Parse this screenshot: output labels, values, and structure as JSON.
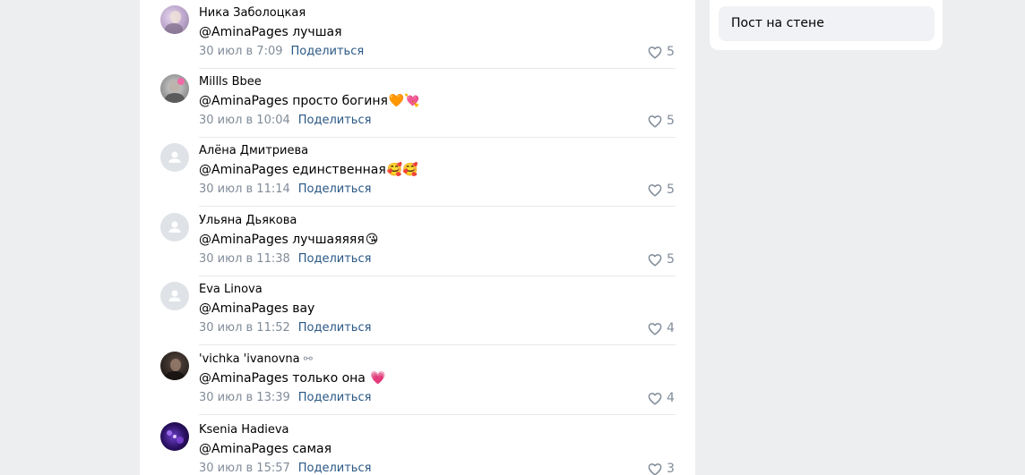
{
  "sidebar": {
    "item_label": "Пост на стене"
  },
  "comments": [
    {
      "author": "Ника Заболоцкая",
      "text": "@AminaPages лучшая",
      "emoji": "",
      "author_emoji": "",
      "date": "30 июл в 7:09",
      "share": "Поделиться",
      "likes": "5",
      "avatar": "photo-lavender"
    },
    {
      "author": "Millls Bbee",
      "text": "@AminaPages просто богиня",
      "emoji": "🧡💘",
      "author_emoji": "",
      "date": "30 июл в 10:04",
      "share": "Поделиться",
      "likes": "5",
      "avatar": "photo-grey-pink"
    },
    {
      "author": "Алёна Дмитриева",
      "text": "@AminaPages единственная",
      "emoji": "🥰🥰",
      "author_emoji": "",
      "date": "30 июл в 11:14",
      "share": "Поделиться",
      "likes": "5",
      "avatar": "placeholder"
    },
    {
      "author": "Ульяна Дьякова",
      "text": "@AminaPages лучшаяяяя",
      "emoji": "😘",
      "author_emoji": "",
      "date": "30 июл в 11:38",
      "share": "Поделиться",
      "likes": "5",
      "avatar": "placeholder"
    },
    {
      "author": "Eva Linova",
      "text": "@AminaPages вау",
      "emoji": "",
      "author_emoji": "",
      "date": "30 июл в 11:52",
      "share": "Поделиться",
      "likes": "4",
      "avatar": "placeholder"
    },
    {
      "author": "'vichka 'ivanovna",
      "text": "@AminaPages только она",
      "emoji": "💗",
      "author_emoji": "⚯",
      "date": "30 июл в 13:39",
      "share": "Поделиться",
      "likes": "4",
      "avatar": "photo-dark"
    },
    {
      "author": "Ksenia Hadieva",
      "text": "@AminaPages самая",
      "emoji": "",
      "author_emoji": "",
      "date": "30 июл в 15:57",
      "share": "Поделиться",
      "likes": "3",
      "avatar": "photo-purple"
    }
  ],
  "colors": {
    "link": "#2a5885",
    "meta": "#818c99",
    "background": "#edeef0"
  }
}
